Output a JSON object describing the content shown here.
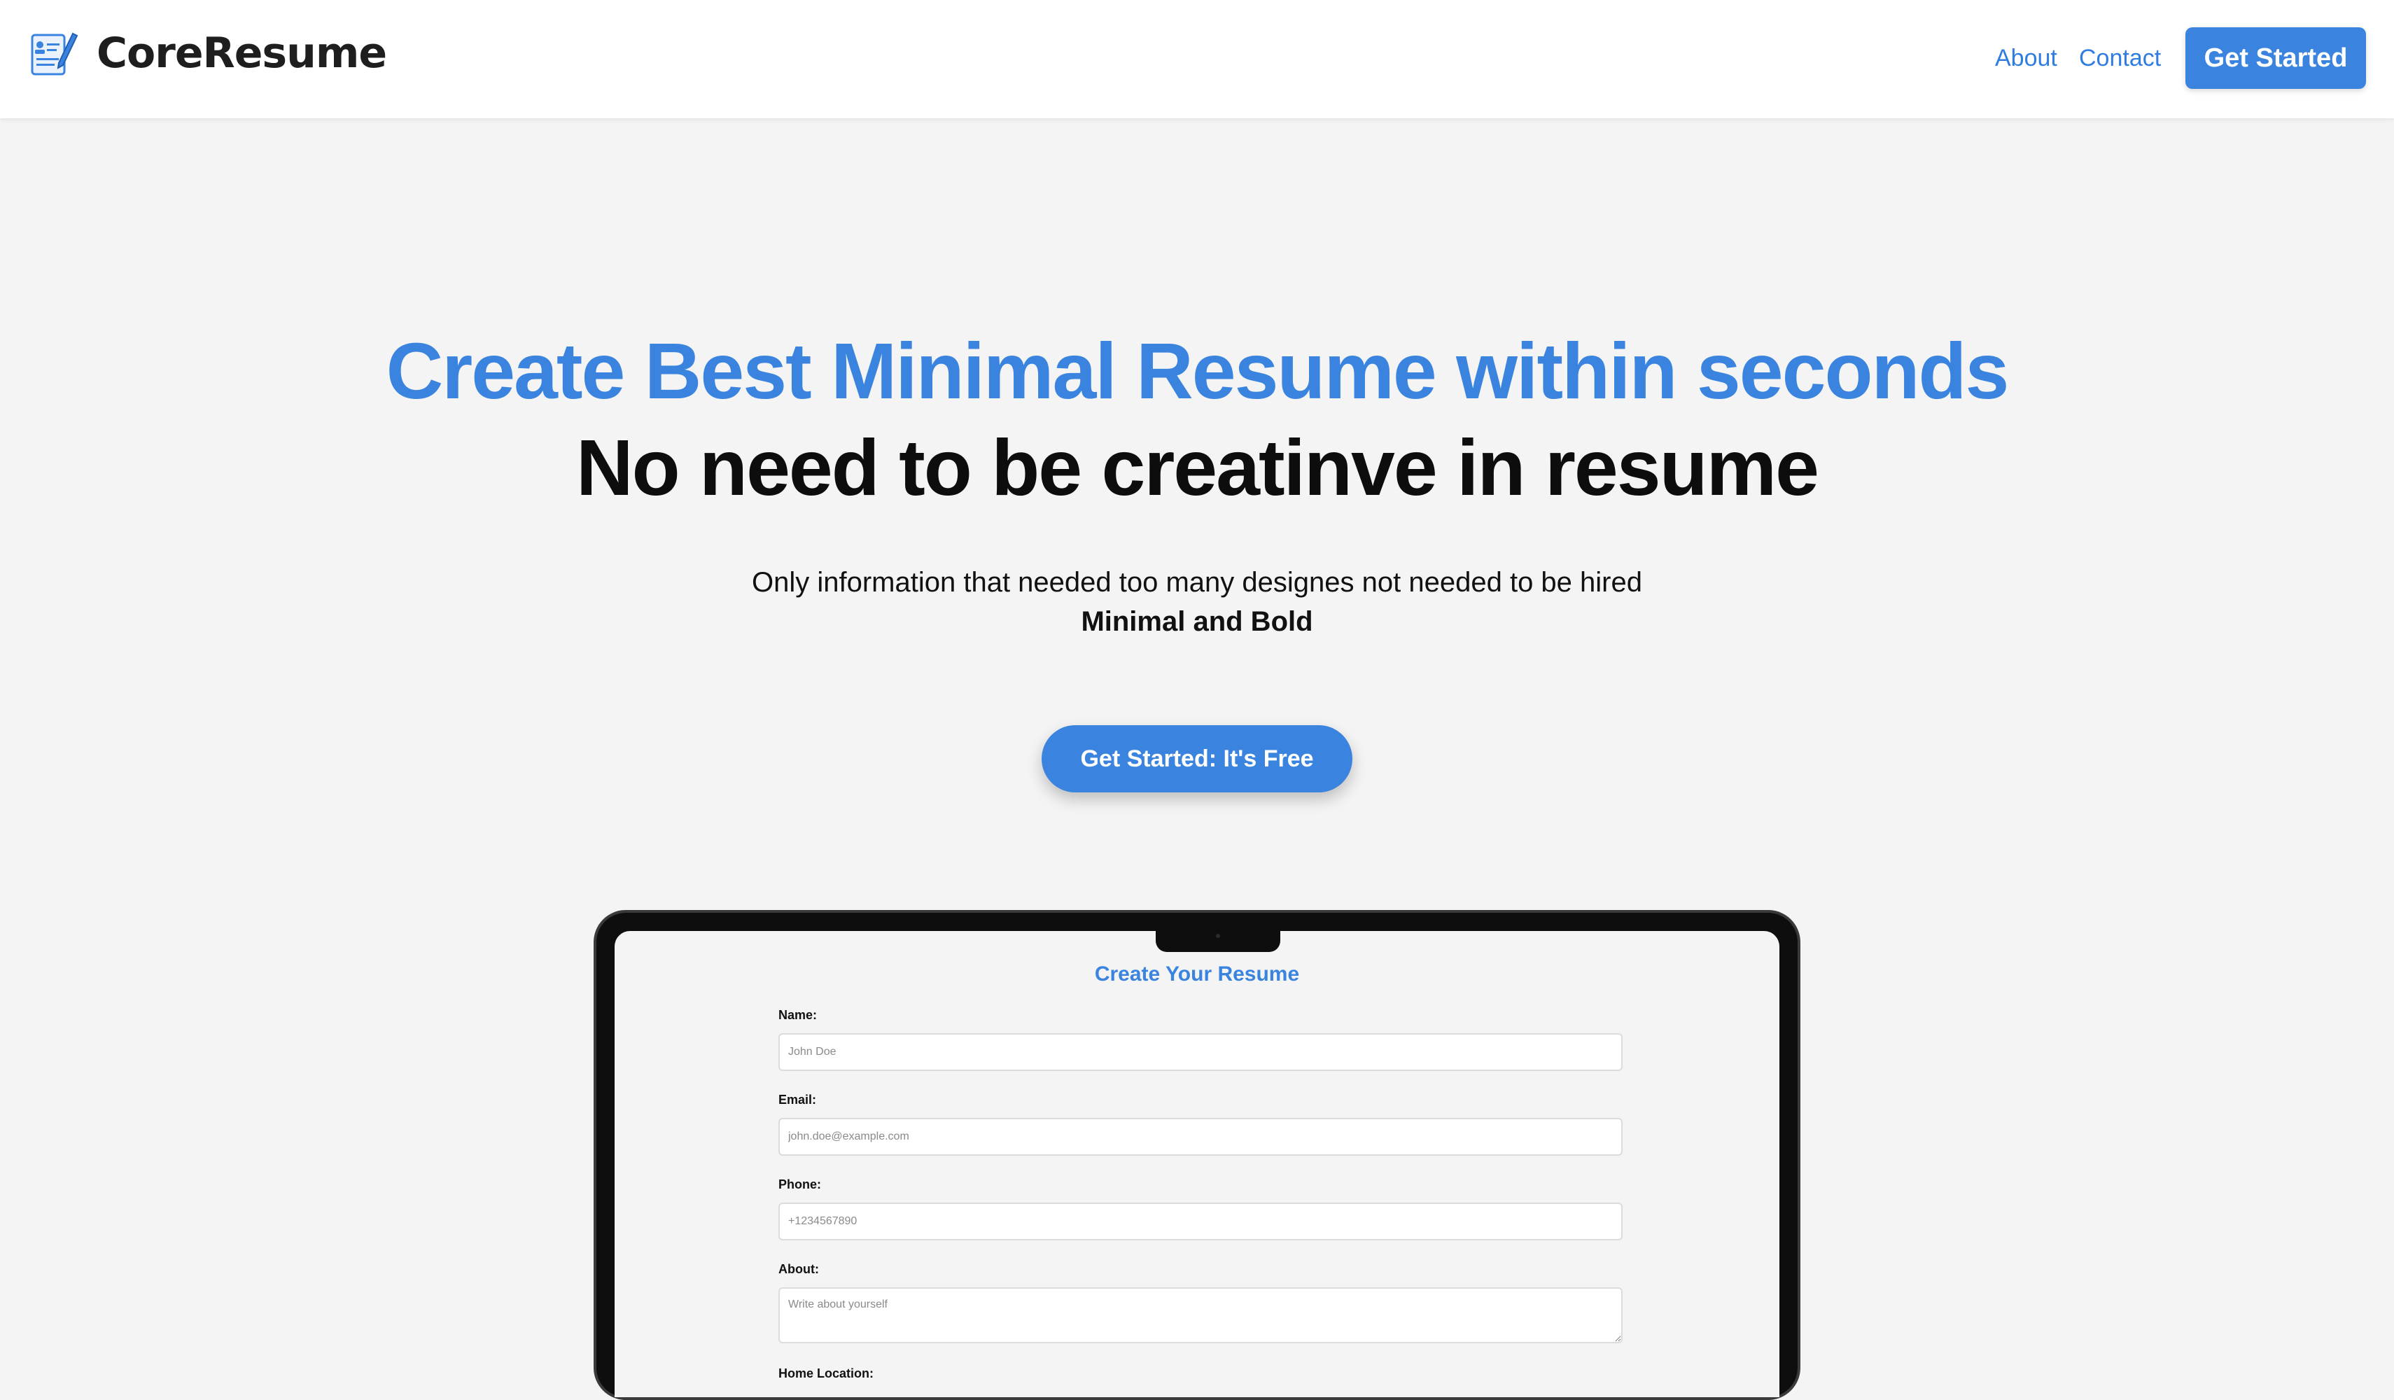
{
  "brand": {
    "name": "CoreResume",
    "logo_icon": "resume-document-pencil-icon"
  },
  "nav": {
    "about": "About",
    "contact": "Contact",
    "get_started": "Get Started"
  },
  "hero": {
    "title": "Create Best Minimal Resume within seconds",
    "subtitle": "No need to be creatinve in resume",
    "description": "Only information that needed too many designes not needed to be hired",
    "description_bold": "Minimal and Bold",
    "cta": "Get Started: It's Free"
  },
  "form": {
    "title": "Create Your Resume",
    "name_label": "Name:",
    "name_placeholder": "John Doe",
    "email_label": "Email:",
    "email_placeholder": "john.doe@example.com",
    "phone_label": "Phone:",
    "phone_placeholder": "+1234567890",
    "about_label": "About:",
    "about_placeholder": "Write about yourself",
    "home_location_label": "Home Location:"
  },
  "colors": {
    "accent": "#3a84e0",
    "text": "#0d0d0d",
    "background": "#f4f4f4"
  }
}
